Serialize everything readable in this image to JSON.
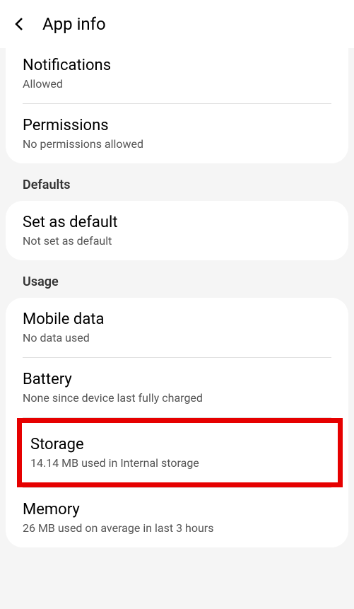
{
  "header": {
    "title": "App info"
  },
  "notifications": {
    "title": "Notifications",
    "subtitle": "Allowed"
  },
  "permissions": {
    "title": "Permissions",
    "subtitle": "No permissions allowed"
  },
  "defaults_section": "Defaults",
  "set_as_default": {
    "title": "Set as default",
    "subtitle": "Not set as default"
  },
  "usage_section": "Usage",
  "mobile_data": {
    "title": "Mobile data",
    "subtitle": "No data used"
  },
  "battery": {
    "title": "Battery",
    "subtitle": "None since device last fully charged"
  },
  "storage": {
    "title": "Storage",
    "subtitle": "14.14 MB used in Internal storage"
  },
  "memory": {
    "title": "Memory",
    "subtitle": "26 MB used on average in last 3 hours"
  }
}
